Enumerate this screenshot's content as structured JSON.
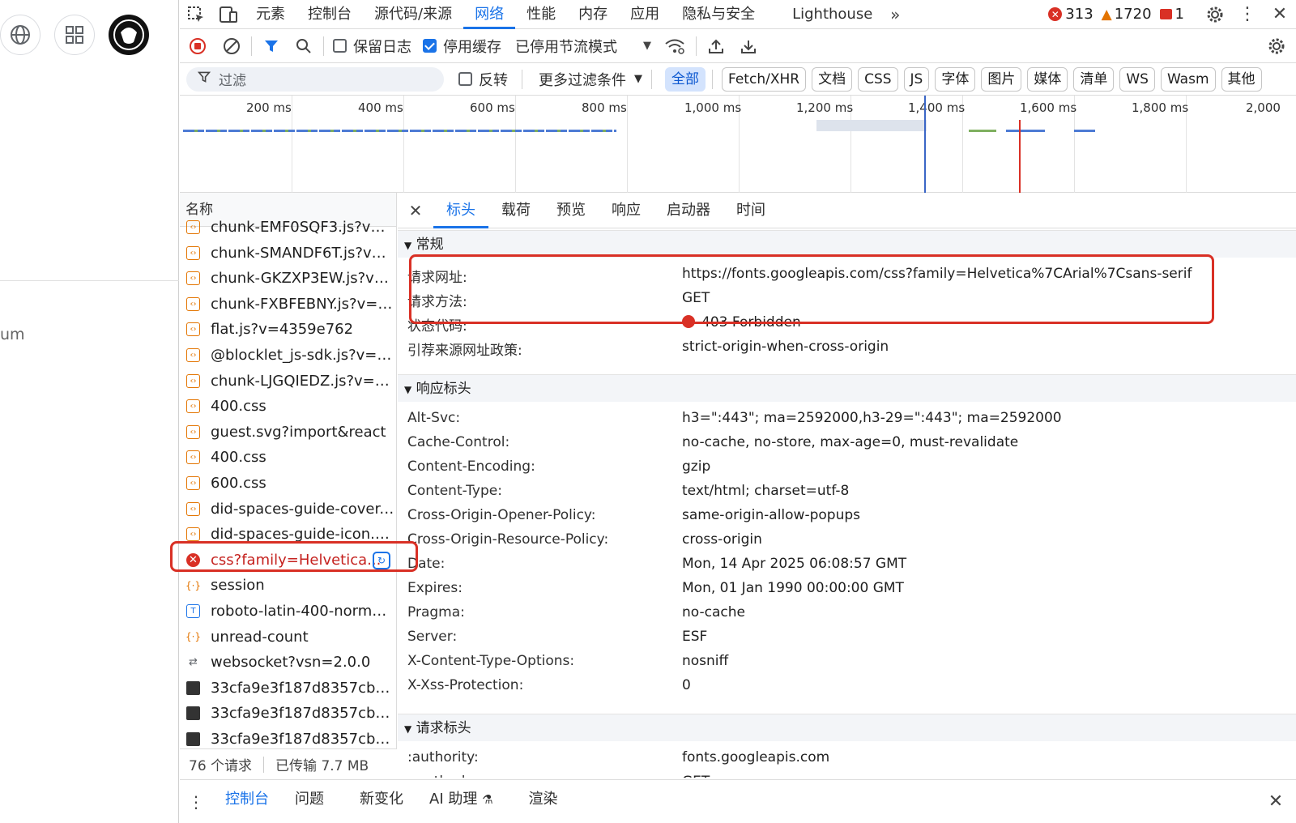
{
  "devtools": {
    "tabs": [
      "元素",
      "控制台",
      "源代码/来源",
      "网络",
      "性能",
      "内存",
      "应用",
      "隐私与安全",
      "Lighthouse"
    ],
    "active_tab": "网络",
    "error_count": "313",
    "warning_count": "1720",
    "issue_count": "1"
  },
  "page_fragment": "um",
  "toolbar": {
    "preserve_log": "保留日志",
    "disable_cache": "停用缓存",
    "throttling": "已停用节流模式"
  },
  "filter": {
    "placeholder": "过滤",
    "invert": "反转",
    "more_filters": "更多过滤条件",
    "types": [
      "全部",
      "Fetch/XHR",
      "文档",
      "CSS",
      "JS",
      "字体",
      "图片",
      "媒体",
      "清单",
      "WS",
      "Wasm",
      "其他"
    ]
  },
  "timeline": {
    "ticks": [
      "200 ms",
      "400 ms",
      "600 ms",
      "800 ms",
      "1,000 ms",
      "1,200 ms",
      "1,400 ms",
      "1,600 ms",
      "1,800 ms",
      "2,000"
    ]
  },
  "requests": {
    "header": "名称",
    "items": [
      {
        "name": "chunk-EMF0SQF3.js?v=4...",
        "type": "js"
      },
      {
        "name": "chunk-SMANDF6T.js?v=...",
        "type": "js"
      },
      {
        "name": "chunk-GKZXP3EW.js?v=...",
        "type": "js"
      },
      {
        "name": "chunk-FXBFEBNY.js?v=4...",
        "type": "js"
      },
      {
        "name": "flat.js?v=4359e762",
        "type": "js"
      },
      {
        "name": "@blocklet_js-sdk.js?v=4...",
        "type": "js"
      },
      {
        "name": "chunk-LJGQIEDZ.js?v=4...",
        "type": "js"
      },
      {
        "name": "400.css",
        "type": "css"
      },
      {
        "name": "guest.svg?import&react",
        "type": "js"
      },
      {
        "name": "400.css",
        "type": "css"
      },
      {
        "name": "600.css",
        "type": "css"
      },
      {
        "name": "did-spaces-guide-cover....",
        "type": "js"
      },
      {
        "name": "did-spaces-guide-icon.s...",
        "type": "js"
      },
      {
        "name": "css?family=Helvetica...",
        "type": "error"
      },
      {
        "name": "session",
        "type": "xhr"
      },
      {
        "name": "roboto-latin-400-normal....",
        "type": "font"
      },
      {
        "name": "unread-count",
        "type": "xhr"
      },
      {
        "name": "websocket?vsn=2.0.0",
        "type": "ws"
      },
      {
        "name": "33cfa9e3f187d8357cb34...",
        "type": "img"
      },
      {
        "name": "33cfa9e3f187d8357cb34...",
        "type": "img"
      },
      {
        "name": "33cfa9e3f187d8357cb34...",
        "type": "img"
      }
    ],
    "footer_count": "76 个请求",
    "footer_transferred": "已传输 7.7 MB"
  },
  "detail": {
    "tabs": [
      "标头",
      "载荷",
      "预览",
      "响应",
      "启动器",
      "时间"
    ],
    "active_tab": "标头",
    "general": {
      "title": "常规",
      "rows": [
        {
          "k": "请求网址:",
          "v": "https://fonts.googleapis.com/css?family=Helvetica%7CArial%7Csans-serif"
        },
        {
          "k": "请求方法:",
          "v": "GET"
        },
        {
          "k": "状态代码:",
          "v": "403 Forbidden"
        },
        {
          "k": "引荐来源网址政策:",
          "v": "strict-origin-when-cross-origin"
        }
      ]
    },
    "response_headers": {
      "title": "响应标头",
      "rows": [
        {
          "k": "Alt-Svc:",
          "v": "h3=\":443\"; ma=2592000,h3-29=\":443\"; ma=2592000"
        },
        {
          "k": "Cache-Control:",
          "v": "no-cache, no-store, max-age=0, must-revalidate"
        },
        {
          "k": "Content-Encoding:",
          "v": "gzip"
        },
        {
          "k": "Content-Type:",
          "v": "text/html; charset=utf-8"
        },
        {
          "k": "Cross-Origin-Opener-Policy:",
          "v": "same-origin-allow-popups"
        },
        {
          "k": "Cross-Origin-Resource-Policy:",
          "v": "cross-origin"
        },
        {
          "k": "Date:",
          "v": "Mon, 14 Apr 2025 06:08:57 GMT"
        },
        {
          "k": "Expires:",
          "v": "Mon, 01 Jan 1990 00:00:00 GMT"
        },
        {
          "k": "Pragma:",
          "v": "no-cache"
        },
        {
          "k": "Server:",
          "v": "ESF"
        },
        {
          "k": "X-Content-Type-Options:",
          "v": "nosniff"
        },
        {
          "k": "X-Xss-Protection:",
          "v": "0"
        }
      ]
    },
    "request_headers": {
      "title": "请求标头",
      "rows": [
        {
          "k": ":authority:",
          "v": "fonts.googleapis.com"
        },
        {
          "k": ":method:",
          "v": "GET"
        }
      ]
    }
  },
  "drawer": {
    "tabs": [
      "控制台",
      "问题",
      "新变化",
      "AI 助理",
      "渲染"
    ],
    "active_tab": "控制台"
  },
  "colors": {
    "accent": "#1a73e8",
    "error": "#d93025",
    "highlight_box": "#d93025"
  }
}
